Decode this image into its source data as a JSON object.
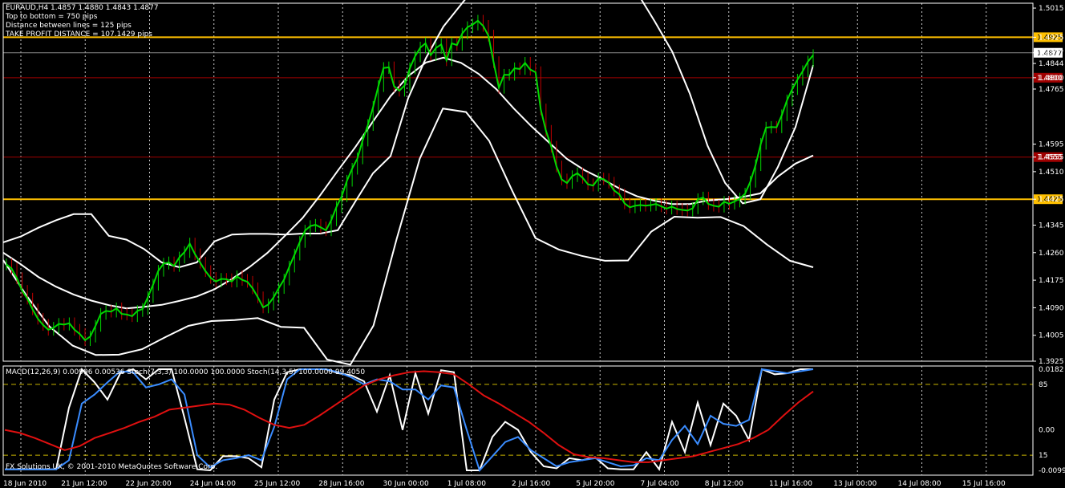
{
  "header": {
    "title": "EURAUD,H4  1.4857 1.4880 1.4843 1.4877",
    "lines": [
      "Top to bottom = 750 pips",
      "Distance between lines = 125 pips",
      "TAKE PROFIT DISTANCE = 107.1429 pips"
    ]
  },
  "indicator_label": "MACD(12,26,9) 0.00996 0.00536  Stoch(7,3,3) 100.0000 100.0000  Stoch(14,3,5) 100.0000 99.4050",
  "copyright": "FX Solutions UK, © 2001-2010 MetaQuotes Software Corp.",
  "colors": {
    "background": "#000000",
    "candle_up": "#00d800",
    "candle_down": "#c00000",
    "bollinger": "#ffffff",
    "level_yellow": "#ffc000",
    "level_red": "#a00000",
    "macd_signal": "#e01010",
    "stoch_fast": "#ffffff",
    "stoch_slow": "#3a8cff",
    "stoch_level": "#c8b400"
  },
  "chart_data": [
    {
      "type": "line",
      "title": "EURAUD,H4",
      "ylim": [
        1.3925,
        1.503
      ],
      "y_ticks": [
        "1.5015",
        "1.4925",
        "1.4877",
        "1.4844",
        "1.4800",
        "1.4765",
        "1.4595",
        "1.4555",
        "1.4510",
        "1.4425",
        "1.4345",
        "1.4260",
        "1.4175",
        "1.4090",
        "1.4005",
        "1.3925"
      ],
      "x_ticks": [
        "18 Jun 2010",
        "21 Jun 12:00",
        "22 Jun 20:00",
        "24 Jun 04:00",
        "25 Jun 12:00",
        "28 Jun 16:00",
        "30 Jun 00:00",
        "1 Jul 08:00",
        "2 Jul 16:00",
        "5 Jul 20:00",
        "7 Jul 04:00",
        "8 Jul 12:00",
        "11 Jul 16:00",
        "13 Jul 00:00",
        "14 Jul 08:00",
        "15 Jul 16:00"
      ],
      "horizontal_levels": [
        {
          "label": "1.4925",
          "value": 1.4925,
          "color": "#ffc000"
        },
        {
          "label": "1.4800",
          "value": 1.48,
          "color": "#a00000"
        },
        {
          "label": "1.4555",
          "value": 1.4555,
          "color": "#a00000"
        },
        {
          "label": "1.4425",
          "value": 1.4425,
          "color": "#ffc000"
        }
      ],
      "current_price": {
        "label": "1.4877",
        "value": 1.4877
      },
      "series": [
        {
          "role": "close",
          "values": [
            1.4224,
            1.4211,
            1.4181,
            1.4142,
            1.4118,
            1.4085,
            1.4056,
            1.4037,
            1.4022,
            1.4028,
            1.404,
            1.4038,
            1.4042,
            1.4022,
            1.4009,
            1.399,
            1.4001,
            1.4034,
            1.4071,
            1.408,
            1.4078,
            1.4088,
            1.4071,
            1.4069,
            1.4064,
            1.408,
            1.4086,
            1.4123,
            1.4161,
            1.4204,
            1.4226,
            1.423,
            1.4219,
            1.4245,
            1.4262,
            1.4288,
            1.4255,
            1.4229,
            1.4203,
            1.4182,
            1.4171,
            1.4179,
            1.4178,
            1.4171,
            1.4187,
            1.4176,
            1.417,
            1.415,
            1.4122,
            1.4091,
            1.41,
            1.4122,
            1.4151,
            1.4177,
            1.4217,
            1.4254,
            1.4293,
            1.4328,
            1.4342,
            1.4346,
            1.4338,
            1.4329,
            1.436,
            1.4401,
            1.4434,
            1.4482,
            1.4519,
            1.4551,
            1.4606,
            1.4654,
            1.471,
            1.4774,
            1.483,
            1.4832,
            1.4774,
            1.476,
            1.4776,
            1.4829,
            1.4866,
            1.4893,
            1.4906,
            1.487,
            1.4892,
            1.4903,
            1.4854,
            1.4906,
            1.4901,
            1.4936,
            1.4956,
            1.4964,
            1.4976,
            1.496,
            1.493,
            1.4848,
            1.4769,
            1.4809,
            1.4809,
            1.4829,
            1.4827,
            1.4846,
            1.4825,
            1.4817,
            1.4702,
            1.4636,
            1.4587,
            1.4526,
            1.4486,
            1.4475,
            1.4496,
            1.4505,
            1.4491,
            1.4471,
            1.4467,
            1.4489,
            1.4487,
            1.4476,
            1.4452,
            1.444,
            1.4412,
            1.44,
            1.4405,
            1.4407,
            1.4405,
            1.4407,
            1.441,
            1.4403,
            1.4396,
            1.4402,
            1.4395,
            1.4392,
            1.439,
            1.4397,
            1.4425,
            1.443,
            1.441,
            1.4405,
            1.4402,
            1.4417,
            1.4411,
            1.4418,
            1.4427,
            1.4442,
            1.4479,
            1.453,
            1.4596,
            1.4646,
            1.4648,
            1.4647,
            1.4684,
            1.473,
            1.4765,
            1.4794,
            1.482,
            1.485,
            1.487
          ]
        },
        {
          "role": "bollinger_upper",
          "values": [
            1.4292,
            1.431,
            1.4337,
            1.436,
            1.4379,
            1.4379,
            1.4312,
            1.43,
            1.4271,
            1.423,
            1.4215,
            1.423,
            1.4295,
            1.4316,
            1.4318,
            1.4318,
            1.4316,
            1.4319,
            1.4319,
            1.4329,
            1.4418,
            1.4505,
            1.4558,
            1.4737,
            1.486,
            1.4958,
            1.5026,
            1.5093,
            1.5129,
            1.5146,
            1.5155,
            1.5149,
            1.5126,
            1.5101,
            1.5113,
            1.511,
            1.5063,
            1.4974,
            1.488,
            1.475,
            1.459,
            1.4475,
            1.4412,
            1.4425,
            1.4525,
            1.4648,
            1.4839
          ]
        },
        {
          "role": "bollinger_middle",
          "values": [
            1.426,
            1.4224,
            1.4185,
            1.4155,
            1.4131,
            1.4112,
            1.4098,
            1.4088,
            1.4093,
            1.4099,
            1.4111,
            1.4125,
            1.4147,
            1.4179,
            1.4216,
            1.4259,
            1.4312,
            1.4367,
            1.4437,
            1.4513,
            1.4586,
            1.4665,
            1.4743,
            1.4805,
            1.4847,
            1.4862,
            1.4846,
            1.4812,
            1.4765,
            1.4705,
            1.465,
            1.46,
            1.455,
            1.4515,
            1.4488,
            1.4458,
            1.4434,
            1.442,
            1.441,
            1.441,
            1.4421,
            1.4425,
            1.4432,
            1.4443,
            1.4495,
            1.4535,
            1.456
          ]
        },
        {
          "role": "bollinger_lower",
          "values": [
            1.4237,
            1.4128,
            1.4032,
            1.3973,
            1.3944,
            1.3945,
            1.3962,
            1.3999,
            1.4034,
            1.4049,
            1.4052,
            1.4058,
            1.4031,
            1.4028,
            1.393,
            1.3914,
            1.4035,
            1.4302,
            1.455,
            1.4705,
            1.4694,
            1.4605,
            1.445,
            1.4305,
            1.427,
            1.425,
            1.4235,
            1.4236,
            1.4325,
            1.4371,
            1.4368,
            1.437,
            1.4342,
            1.4285,
            1.4235,
            1.4215
          ]
        }
      ]
    },
    {
      "type": "line",
      "title": "MACD(12,26,9)",
      "ylim": [
        0,
        100
      ],
      "y_ticks": [
        "0.0182",
        "85",
        "0.00",
        "15",
        "-0.0099"
      ],
      "stoch_levels": [
        85,
        15
      ],
      "series": [
        {
          "role": "stoch_fast",
          "values": [
            1,
            1,
            1,
            1,
            1,
            62,
            100,
            87,
            70,
            96,
            100,
            90,
            100,
            100,
            52,
            1,
            0,
            14,
            14,
            12,
            3,
            70,
            97,
            100,
            100,
            100,
            96,
            94,
            88,
            58,
            94,
            40,
            96,
            56,
            99,
            97,
            0,
            0,
            33,
            48,
            40,
            18,
            4,
            2,
            12,
            10,
            13,
            2,
            1,
            1,
            18,
            1,
            48,
            18,
            67,
            25,
            66,
            54,
            30,
            100,
            95,
            96,
            100,
            100
          ]
        },
        {
          "role": "stoch_slow",
          "values": [
            1,
            1,
            1,
            1,
            1,
            10,
            66,
            75,
            87,
            98,
            97,
            82,
            85,
            90,
            75,
            15,
            3,
            10,
            12,
            15,
            10,
            43,
            90,
            100,
            100,
            100,
            97,
            92,
            85,
            90,
            88,
            80,
            80,
            70,
            84,
            82,
            40,
            0,
            14,
            28,
            33,
            20,
            12,
            4,
            8,
            10,
            12,
            8,
            4,
            5,
            12,
            10,
            30,
            44,
            26,
            54,
            46,
            44,
            50,
            100,
            98,
            96,
            98,
            100
          ]
        },
        {
          "role": "macd_signal",
          "values": [
            40,
            37,
            32,
            26,
            20,
            24,
            32,
            37,
            42,
            48,
            53,
            60,
            62,
            64,
            66,
            65,
            60,
            52,
            45,
            42,
            45,
            54,
            64,
            74,
            84,
            90,
            94,
            97,
            98,
            97,
            95,
            85,
            74,
            66,
            57,
            48,
            37,
            25,
            16,
            13,
            12,
            10,
            8,
            8,
            10,
            12,
            14,
            18,
            22,
            26,
            32,
            40,
            54,
            67,
            78
          ]
        }
      ]
    }
  ]
}
